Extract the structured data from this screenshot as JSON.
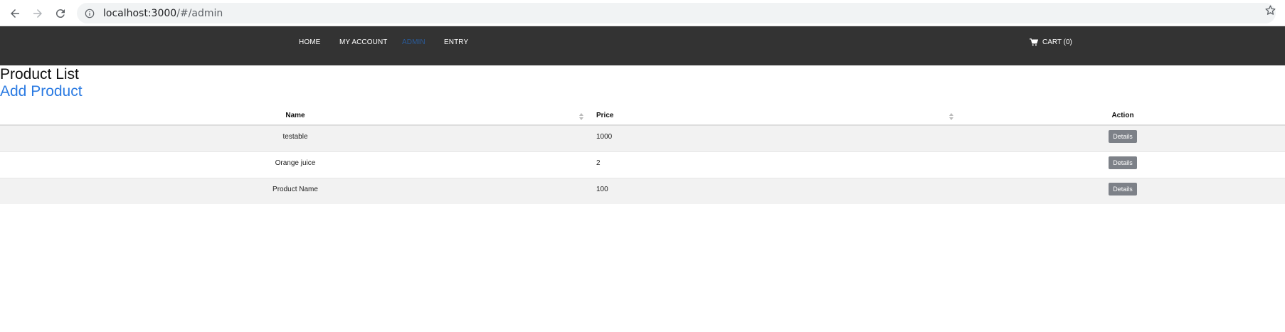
{
  "browser": {
    "url_host": "localhost:3000",
    "url_path": "/#/admin"
  },
  "nav": {
    "items": [
      {
        "label": "HOME",
        "active": false
      },
      {
        "label": "MY ACCOUNT",
        "active": false
      },
      {
        "label": "ADMIN",
        "active": true
      },
      {
        "label": "ENTRY",
        "active": false
      }
    ],
    "cart_label": "CART (0)"
  },
  "page": {
    "title": "Product List",
    "add_link": "Add Product"
  },
  "table": {
    "headers": {
      "name": "Name",
      "price": "Price",
      "action": "Action"
    },
    "rows": [
      {
        "name": "testable",
        "price": "1000",
        "action": "Details"
      },
      {
        "name": "Orange juice",
        "price": "2",
        "action": "Details"
      },
      {
        "name": "Product Name",
        "price": "100",
        "action": "Details"
      }
    ]
  },
  "colors": {
    "nav_bg": "#333333",
    "active_nav": "#2a5b9a",
    "link": "#2a7ae2",
    "button": "#7d8188"
  }
}
